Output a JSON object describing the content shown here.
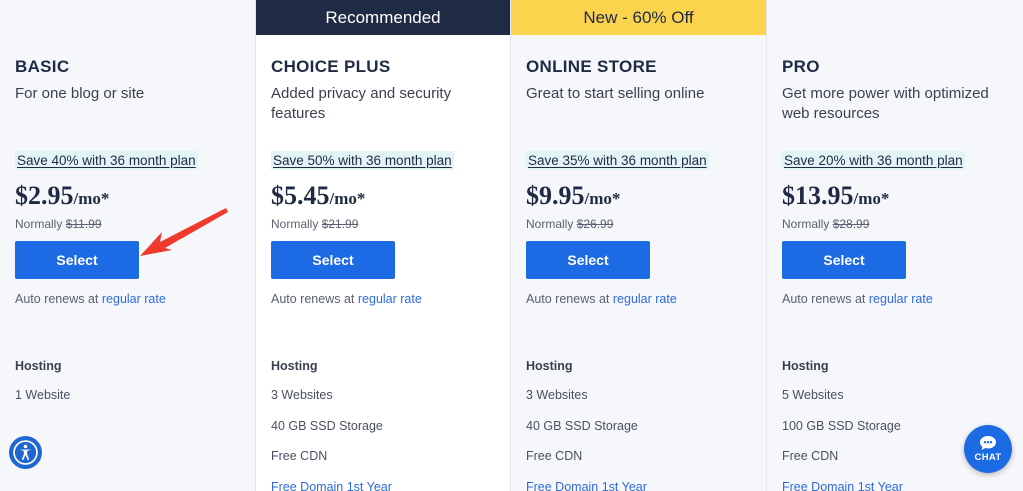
{
  "colors": {
    "accent_blue": "#1d6ae5",
    "dark_badge": "#1f2a44",
    "yellow_badge": "#fcd34d",
    "save_highlight": "#e3f4f6",
    "arrow_red": "#f03a2e"
  },
  "plans": [
    {
      "badge": "",
      "name": "BASIC",
      "description": "For one blog or site",
      "save_note": "Save 40% with 36 month plan",
      "price": "$2.95",
      "price_unit": "/mo*",
      "normally_label": "Normally",
      "normally_price": "$11.99",
      "select_label": "Select",
      "renew_text": "Auto renews at",
      "renew_link": "regular rate",
      "feature_heading": "Hosting",
      "features": [
        "1 Website"
      ]
    },
    {
      "badge": "Recommended",
      "name": "CHOICE PLUS",
      "description": "Added privacy and security features",
      "save_note": "Save 50% with 36 month plan",
      "price": "$5.45",
      "price_unit": "/mo*",
      "normally_label": "Normally",
      "normally_price": "$21.99",
      "select_label": "Select",
      "renew_text": "Auto renews at",
      "renew_link": "regular rate",
      "feature_heading": "Hosting",
      "features": [
        "3 Websites",
        "40 GB SSD Storage",
        "Free CDN",
        "Free Domain 1st Year"
      ]
    },
    {
      "badge": "New - 60% Off",
      "name": "ONLINE STORE",
      "description": "Great to start selling online",
      "save_note": "Save 35% with 36 month plan",
      "price": "$9.95",
      "price_unit": "/mo*",
      "normally_label": "Normally",
      "normally_price": "$26.99",
      "select_label": "Select",
      "renew_text": "Auto renews at",
      "renew_link": "regular rate",
      "feature_heading": "Hosting",
      "features": [
        "3 Websites",
        "40 GB SSD Storage",
        "Free CDN",
        "Free Domain 1st Year"
      ]
    },
    {
      "badge": "",
      "name": "PRO",
      "description": "Get more power with optimized web resources",
      "save_note": "Save 20% with 36 month plan",
      "price": "$13.95",
      "price_unit": "/mo*",
      "normally_label": "Normally",
      "normally_price": "$28.99",
      "select_label": "Select",
      "renew_text": "Auto renews at",
      "renew_link": "regular rate",
      "feature_heading": "Hosting",
      "features": [
        "5 Websites",
        "100 GB SSD Storage",
        "Free CDN",
        "Free Domain 1st Year"
      ]
    }
  ],
  "icons": {
    "accessibility": "accessibility-icon",
    "chat": "chat-icon",
    "annotation_arrow": "red-arrow"
  },
  "chat": {
    "label": "CHAT"
  }
}
